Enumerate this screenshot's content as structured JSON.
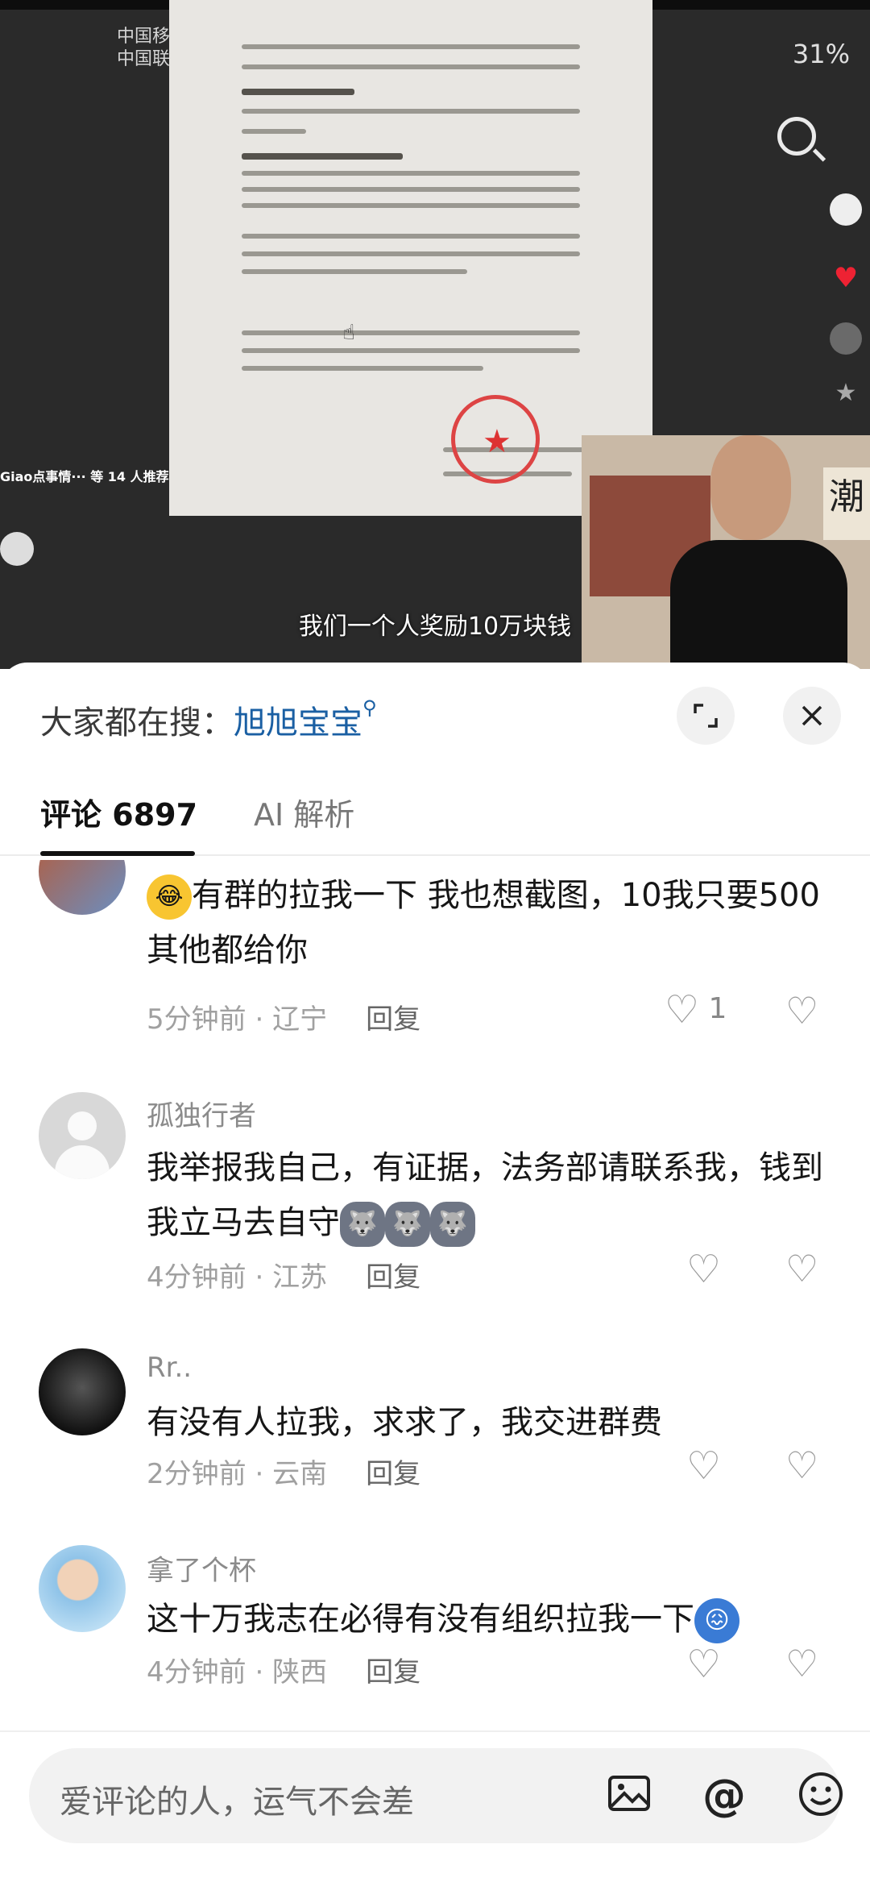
{
  "status_bar": {
    "carrier_1": "中国移",
    "carrier_2": "中国联",
    "battery": "31%"
  },
  "video": {
    "recommend_text": "Giao点事情···  等 14 人推荐",
    "subtitle": "我们一个人奖励10万块钱"
  },
  "sheet": {
    "hot_search_prefix": "大家都在搜：",
    "hot_search_keyword": "旭旭宝宝",
    "tabs": {
      "comments_label": "评论",
      "comments_count": "6897",
      "ai_label": "AI 解析"
    }
  },
  "comments": [
    {
      "username": "",
      "text": "有群的拉我一下 我也想截图，10我只要500其他都给你",
      "time": "5分钟前",
      "location": "辽宁",
      "reply_label": "回复",
      "likes": "1"
    },
    {
      "username": "孤独行者",
      "text": "我举报我自己，有证据，法务部请联系我，钱到我立马去自守",
      "time": "4分钟前",
      "location": "江苏",
      "reply_label": "回复",
      "likes": ""
    },
    {
      "username": "Rr..",
      "text": "有没有人拉我，求求了，我交进群费",
      "time": "2分钟前",
      "location": "云南",
      "reply_label": "回复",
      "likes": ""
    },
    {
      "username": "拿了个杯",
      "text": "这十万我志在必得有没有组织拉我一下",
      "time": "4分钟前",
      "location": "陕西",
      "reply_label": "回复",
      "likes": ""
    }
  ],
  "input": {
    "placeholder": "爱评论的人，运气不会差"
  },
  "icons": {
    "expand": "expand-icon",
    "close": "close-icon",
    "like": "heart-icon",
    "dislike": "broken-heart-icon",
    "image": "image-icon",
    "at": "at-icon",
    "emoji": "emoji-icon"
  },
  "colors": {
    "keyword_blue": "#1a5fa3",
    "text_gray": "#8b8b8b"
  }
}
